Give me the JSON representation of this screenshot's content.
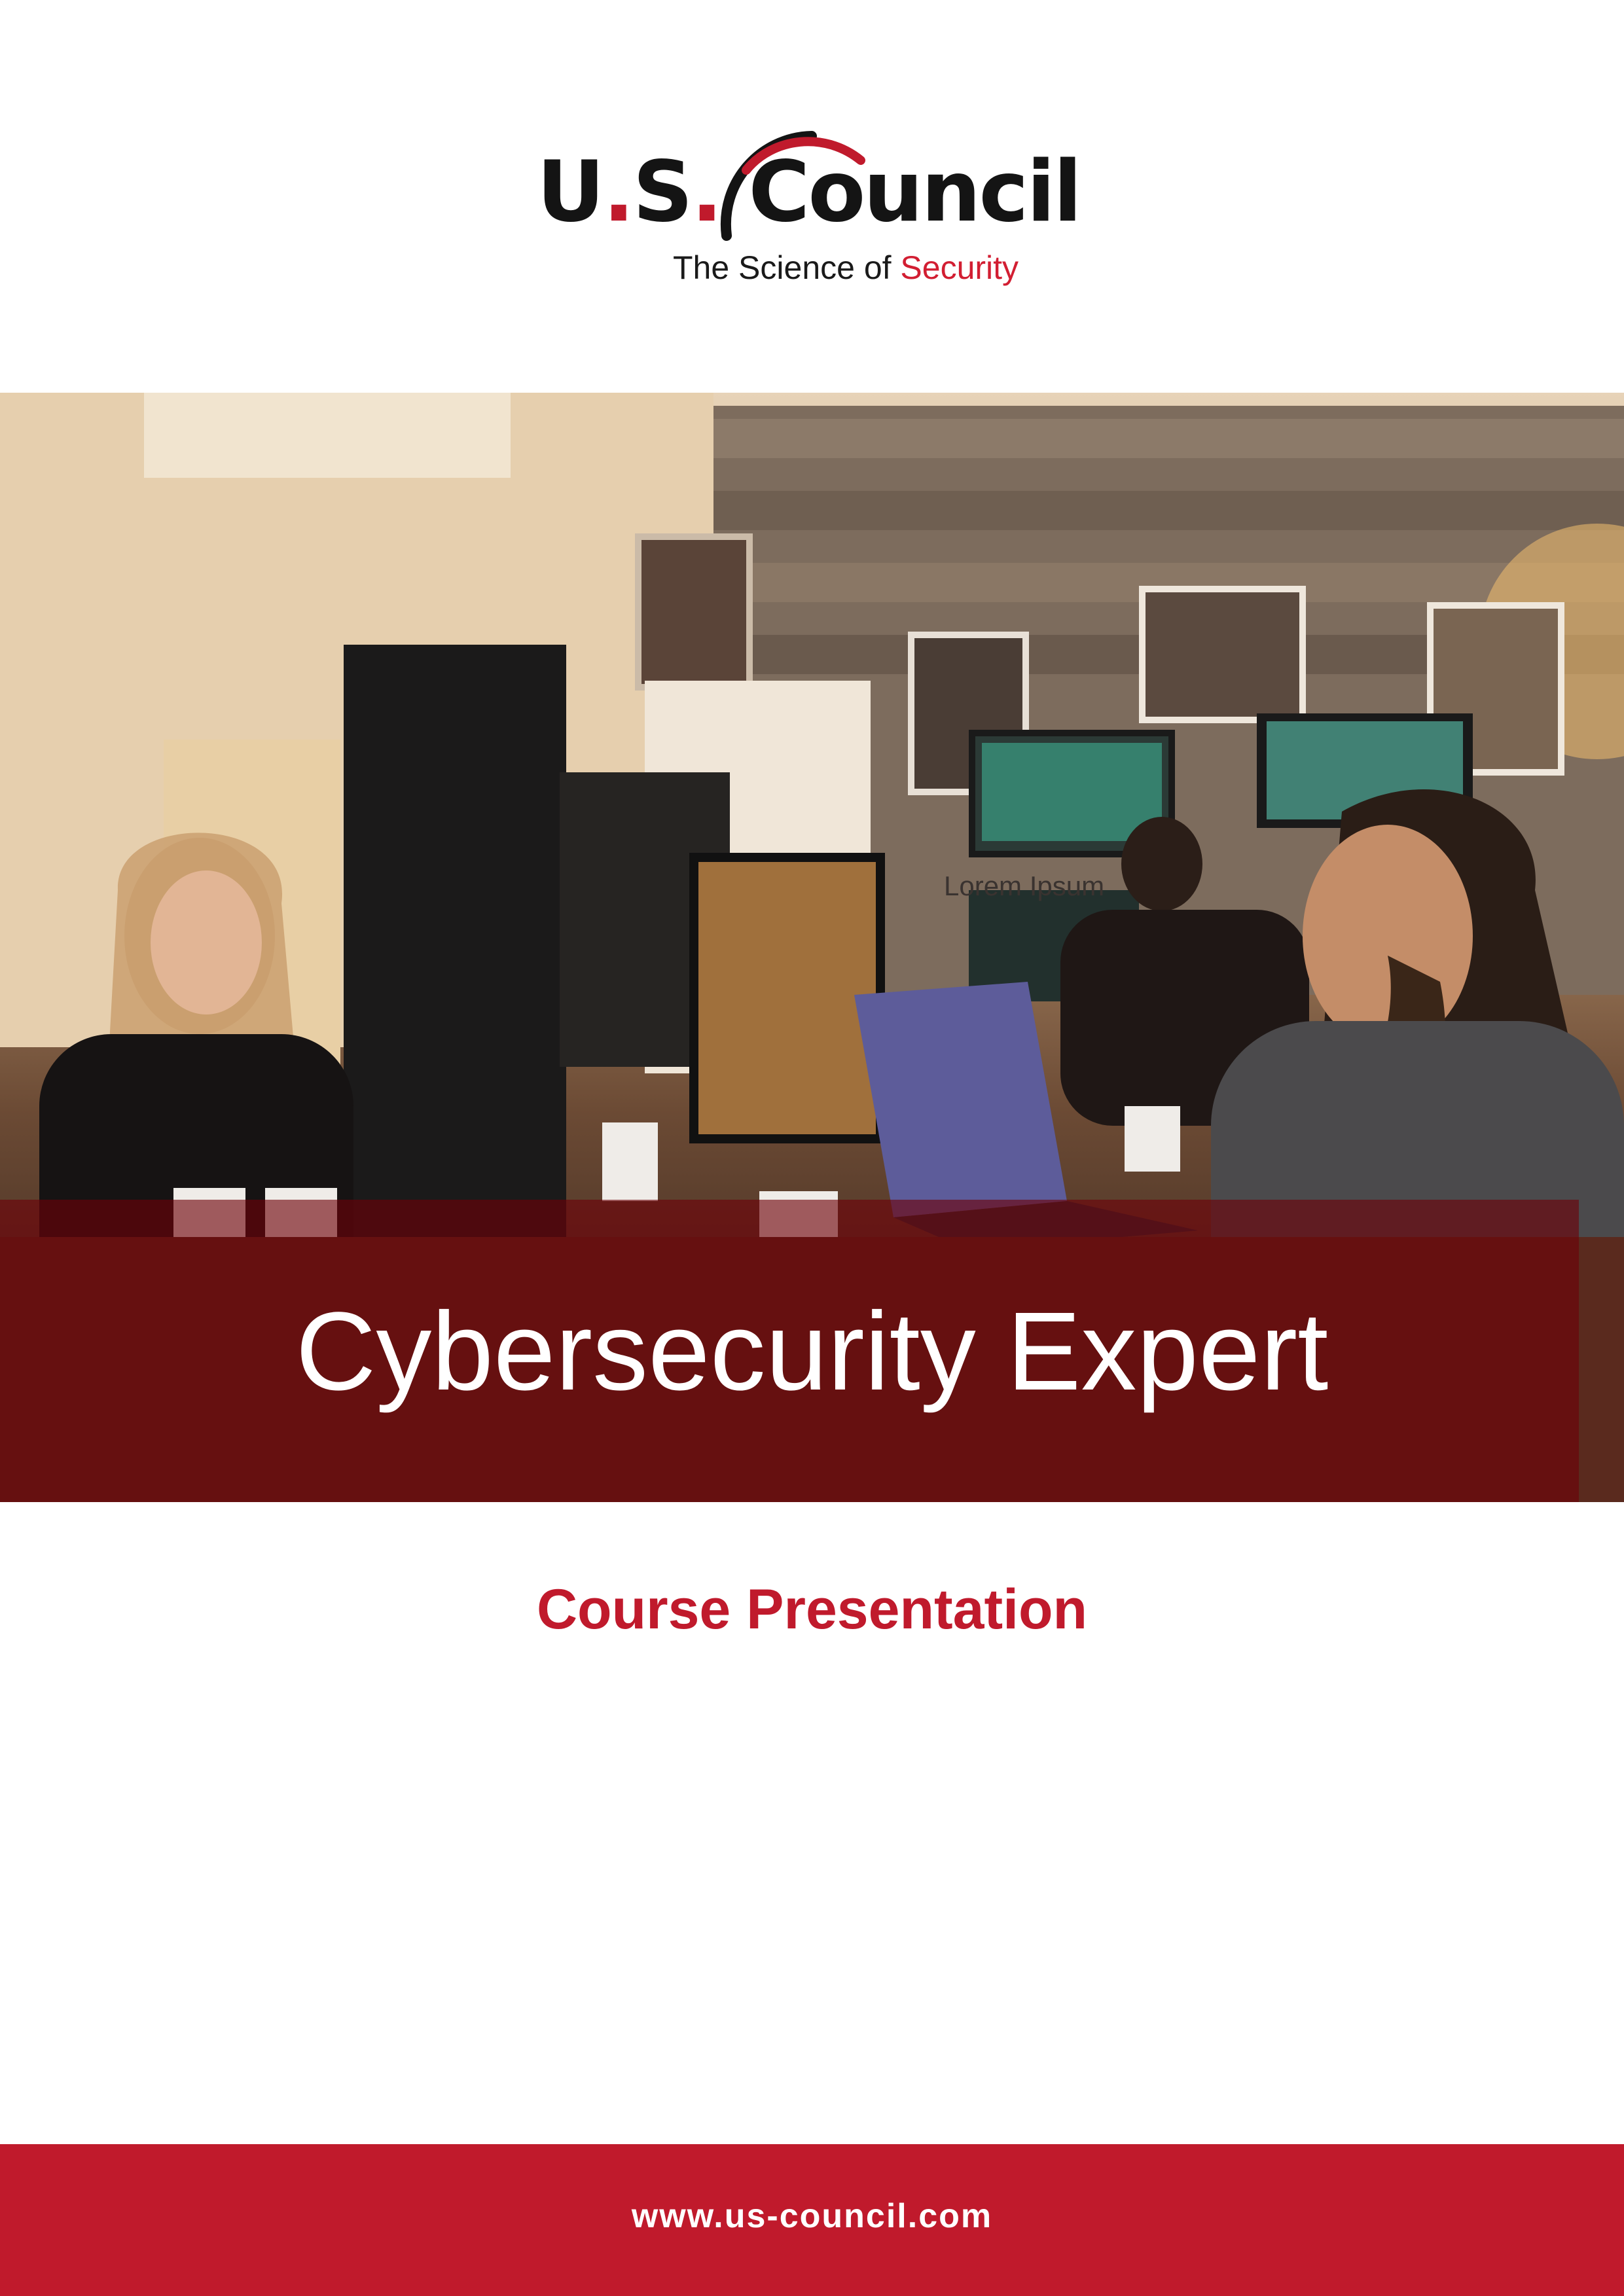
{
  "brand": {
    "logo_part1": "U",
    "logo_dot1": ".",
    "logo_part2": "S",
    "logo_dot2": ".",
    "logo_part3": "Council",
    "tagline_prefix": "The Science of ",
    "tagline_accent": "Security",
    "accent_color": "#c01a2c"
  },
  "hero": {
    "caption": "Lorem Ipsum",
    "title": "Cybersecurity Expert"
  },
  "subtitle": "Course Presentation",
  "footer": {
    "url": "www.us-council.com"
  }
}
